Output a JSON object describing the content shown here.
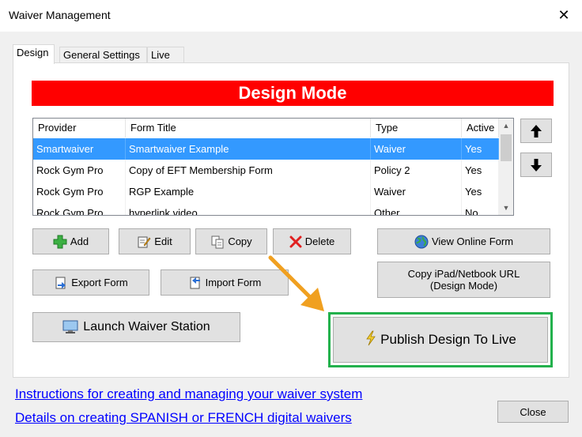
{
  "window": {
    "title": "Waiver Management",
    "close_glyph": "✕"
  },
  "tabs": [
    {
      "label": "Design",
      "active": true
    },
    {
      "label": "General Settings",
      "active": false
    },
    {
      "label": "Live",
      "active": false
    }
  ],
  "banner": {
    "text": "Design Mode",
    "color": "#ff0000"
  },
  "table": {
    "columns": [
      "Provider",
      "Form Title",
      "Type",
      "Active"
    ],
    "rows": [
      {
        "provider": "Smartwaiver",
        "form_title": "Smartwaiver Example",
        "type": "Waiver",
        "active": "Yes",
        "selected": true
      },
      {
        "provider": "Rock Gym Pro",
        "form_title": "Copy of EFT Membership Form",
        "type": "Policy 2",
        "active": "Yes",
        "selected": false
      },
      {
        "provider": "Rock Gym Pro",
        "form_title": "RGP Example",
        "type": "Waiver",
        "active": "Yes",
        "selected": false
      },
      {
        "provider": "Rock Gym Pro",
        "form_title": "hyperlink video",
        "type": "Other",
        "active": "No",
        "selected": false
      }
    ]
  },
  "buttons": {
    "add": "Add",
    "edit": "Edit",
    "copy": "Copy",
    "delete": "Delete",
    "view_online_form": "View Online Form",
    "export_form": "Export Form",
    "import_form": "Import Form",
    "copy_url_line1": "Copy iPad/Netbook URL",
    "copy_url_line2": "(Design Mode)",
    "launch_waiver_station": "Launch Waiver Station",
    "publish": "Publish Design To Live",
    "close": "Close"
  },
  "links": {
    "instructions": "Instructions for creating and managing your waiver system",
    "spanish_french": "Details on creating SPANISH or FRENCH digital waivers"
  },
  "colors": {
    "selection": "#3399ff",
    "highlight_border": "#22b14c",
    "annotation_arrow": "#f0a020",
    "link": "#0000ff"
  }
}
